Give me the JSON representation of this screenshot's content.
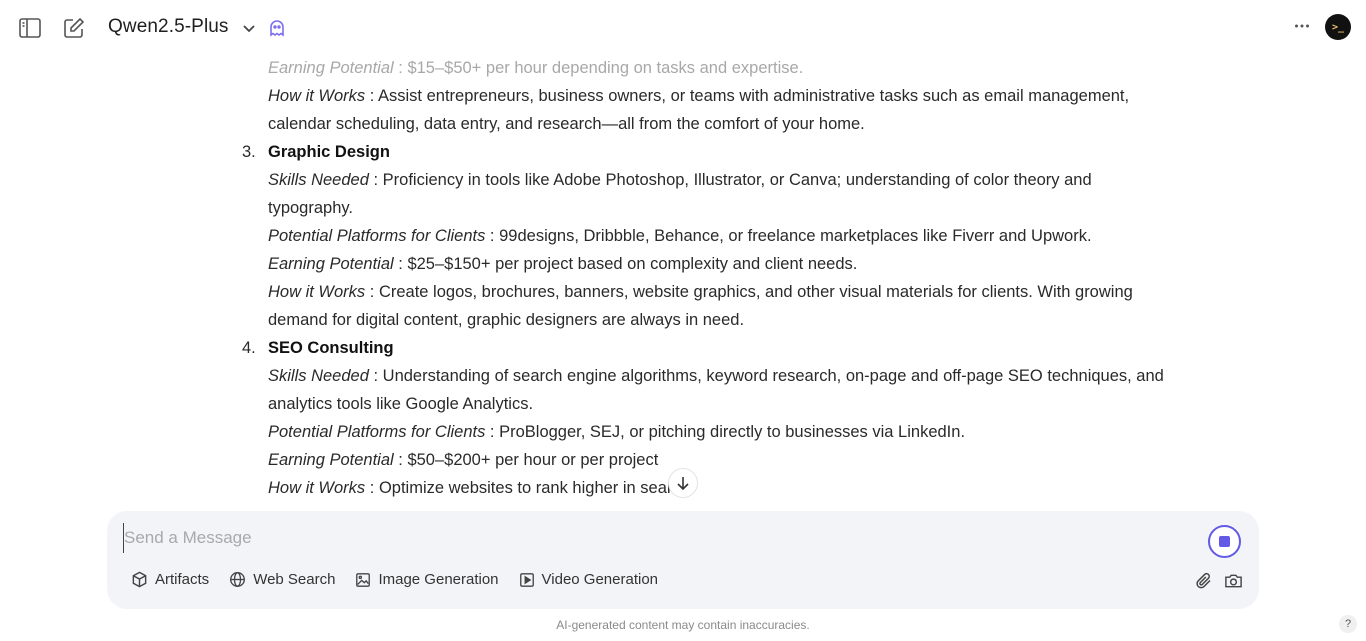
{
  "header": {
    "model_name": "Qwen2.5-Plus",
    "avatar_text": ">_"
  },
  "chat": {
    "lines": {
      "item2_earning_label": "Earning Potential",
      "item2_earning_text": "$15–$50+ per hour depending on tasks and expertise.",
      "item2_how_label": "How it Works",
      "item2_how_text": "Assist entrepreneurs, business owners, or teams with administrative tasks such as email management, calendar scheduling, data entry, and research—all from the comfort of your home."
    },
    "items": [
      {
        "number": "3.",
        "title": "Graphic Design",
        "skills_label": "Skills Needed",
        "skills_text": "Proficiency in tools like Adobe Photoshop, Illustrator, or Canva; understanding of color theory and typography.",
        "platforms_label": "Potential Platforms for Clients",
        "platforms_text": "99designs, Dribbble, Behance, or freelance marketplaces like Fiverr and Upwork.",
        "earning_label": "Earning Potential",
        "earning_text": "$25–$150+ per project based on complexity and client needs.",
        "how_label": "How it Works",
        "how_text": "Create logos, brochures, banners, website graphics, and other visual materials for clients. With growing demand for digital content, graphic designers are always in need."
      },
      {
        "number": "4.",
        "title": "SEO Consulting",
        "skills_label": "Skills Needed",
        "skills_text": "Understanding of search engine algorithms, keyword research, on-page and off-page SEO techniques, and analytics tools like Google Analytics.",
        "platforms_label": "Potential Platforms for Clients",
        "platforms_text": "ProBlogger, SEJ, or pitching directly to businesses via LinkedIn.",
        "earning_label": "Earning Potential",
        "earning_text": "$50–$200+ per hour or per project",
        "how_label": "How it Works",
        "how_text": "Optimize websites to rank higher in search"
      }
    ]
  },
  "composer": {
    "placeholder": "Send a Message",
    "tools": [
      "Artifacts",
      "Web Search",
      "Image Generation",
      "Video Generation"
    ]
  },
  "footer": {
    "note": "AI-generated content may contain inaccuracies.",
    "help": "?"
  },
  "colors": {
    "accent": "#6259e6",
    "composer_bg": "#f3f4f7"
  }
}
